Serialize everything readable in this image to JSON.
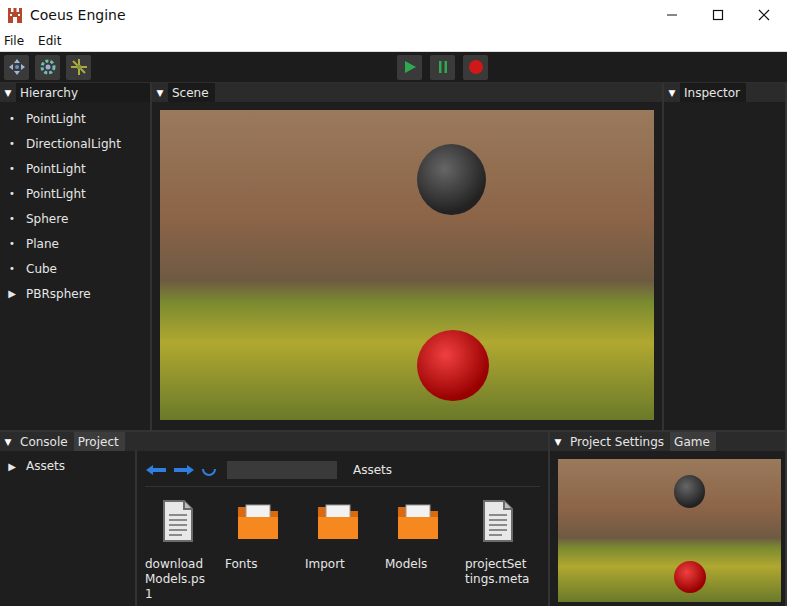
{
  "window": {
    "title": "Coeus Engine"
  },
  "menu": [
    "File",
    "Edit"
  ],
  "hierarchy": {
    "toggle": "▼",
    "title": "Hierarchy",
    "items": [
      {
        "label": "PointLight",
        "icon": "•",
        "expanded": false
      },
      {
        "label": "DirectionalLight",
        "icon": "•",
        "expanded": false
      },
      {
        "label": "PointLight",
        "icon": "•",
        "expanded": false
      },
      {
        "label": "PointLight",
        "icon": "•",
        "expanded": false
      },
      {
        "label": "Sphere",
        "icon": "•",
        "expanded": false
      },
      {
        "label": "Plane",
        "icon": "•",
        "expanded": false
      },
      {
        "label": "Cube",
        "icon": "•",
        "expanded": false
      },
      {
        "label": "PBRsphere",
        "icon": "▶",
        "expanded": false
      }
    ]
  },
  "scene": {
    "toggle": "▼",
    "title": "Scene"
  },
  "inspector": {
    "toggle": "▼",
    "title": "Inspector"
  },
  "bottom_left": {
    "toggle": "▼",
    "tabs": [
      {
        "label": "Console",
        "selected": false
      },
      {
        "label": "Project",
        "selected": true
      }
    ]
  },
  "project": {
    "tree": [
      {
        "icon": "▶",
        "label": "Assets",
        "expanded": false
      }
    ],
    "search": {
      "value": ""
    },
    "breadcrumb": "Assets",
    "files": [
      {
        "name": "downloadModels.ps1",
        "kind": "file"
      },
      {
        "name": "Fonts",
        "kind": "folder"
      },
      {
        "name": "Import",
        "kind": "folder"
      },
      {
        "name": "Models",
        "kind": "folder"
      },
      {
        "name": "projectSettings.meta",
        "kind": "file"
      }
    ]
  },
  "bottom_right": {
    "toggle": "▼",
    "tabs": [
      {
        "label": "Project Settings",
        "selected": false
      },
      {
        "label": "Game",
        "selected": true
      }
    ]
  }
}
